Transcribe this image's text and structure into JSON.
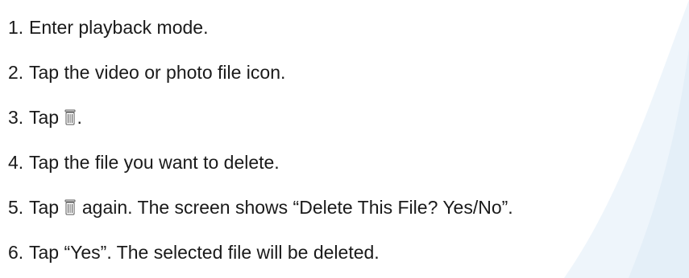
{
  "steps": [
    {
      "number": "1.",
      "text": "Enter playback mode."
    },
    {
      "number": "2.",
      "text": "Tap the video or photo file icon."
    },
    {
      "number": "3.",
      "text_before": "Tap",
      "icon": "trash-icon",
      "text_after": "."
    },
    {
      "number": "4.",
      "text": "Tap the file you want to delete."
    },
    {
      "number": "5.",
      "text_before": "Tap",
      "icon": "trash-icon",
      "text_after": "again. The screen shows “Delete This File? Yes/No”."
    },
    {
      "number": "6.",
      "text": "Tap “Yes”. The selected file will be deleted."
    }
  ],
  "colors": {
    "text": "#1a1a1a",
    "background_swoosh": "#eef5fb"
  }
}
